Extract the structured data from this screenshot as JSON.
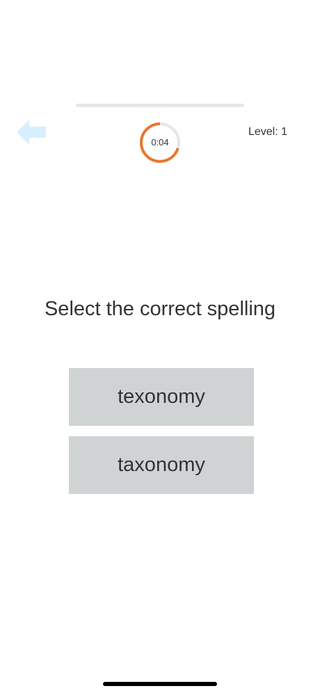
{
  "header": {
    "back_icon": "arrow-left-icon",
    "timer": {
      "label": "0:04",
      "fraction_elapsed": 0.7,
      "ring_color": "#e8772e",
      "track_color": "#e6e6e6"
    },
    "level_label": "Level: 1",
    "progress_fraction": 0
  },
  "quiz": {
    "prompt": "Select the correct spelling",
    "options": [
      {
        "label": "texonomy"
      },
      {
        "label": "taxonomy"
      }
    ]
  },
  "colors": {
    "back_arrow": "#d6efff",
    "option_background": "#d0d3d4",
    "text": "#333333"
  }
}
